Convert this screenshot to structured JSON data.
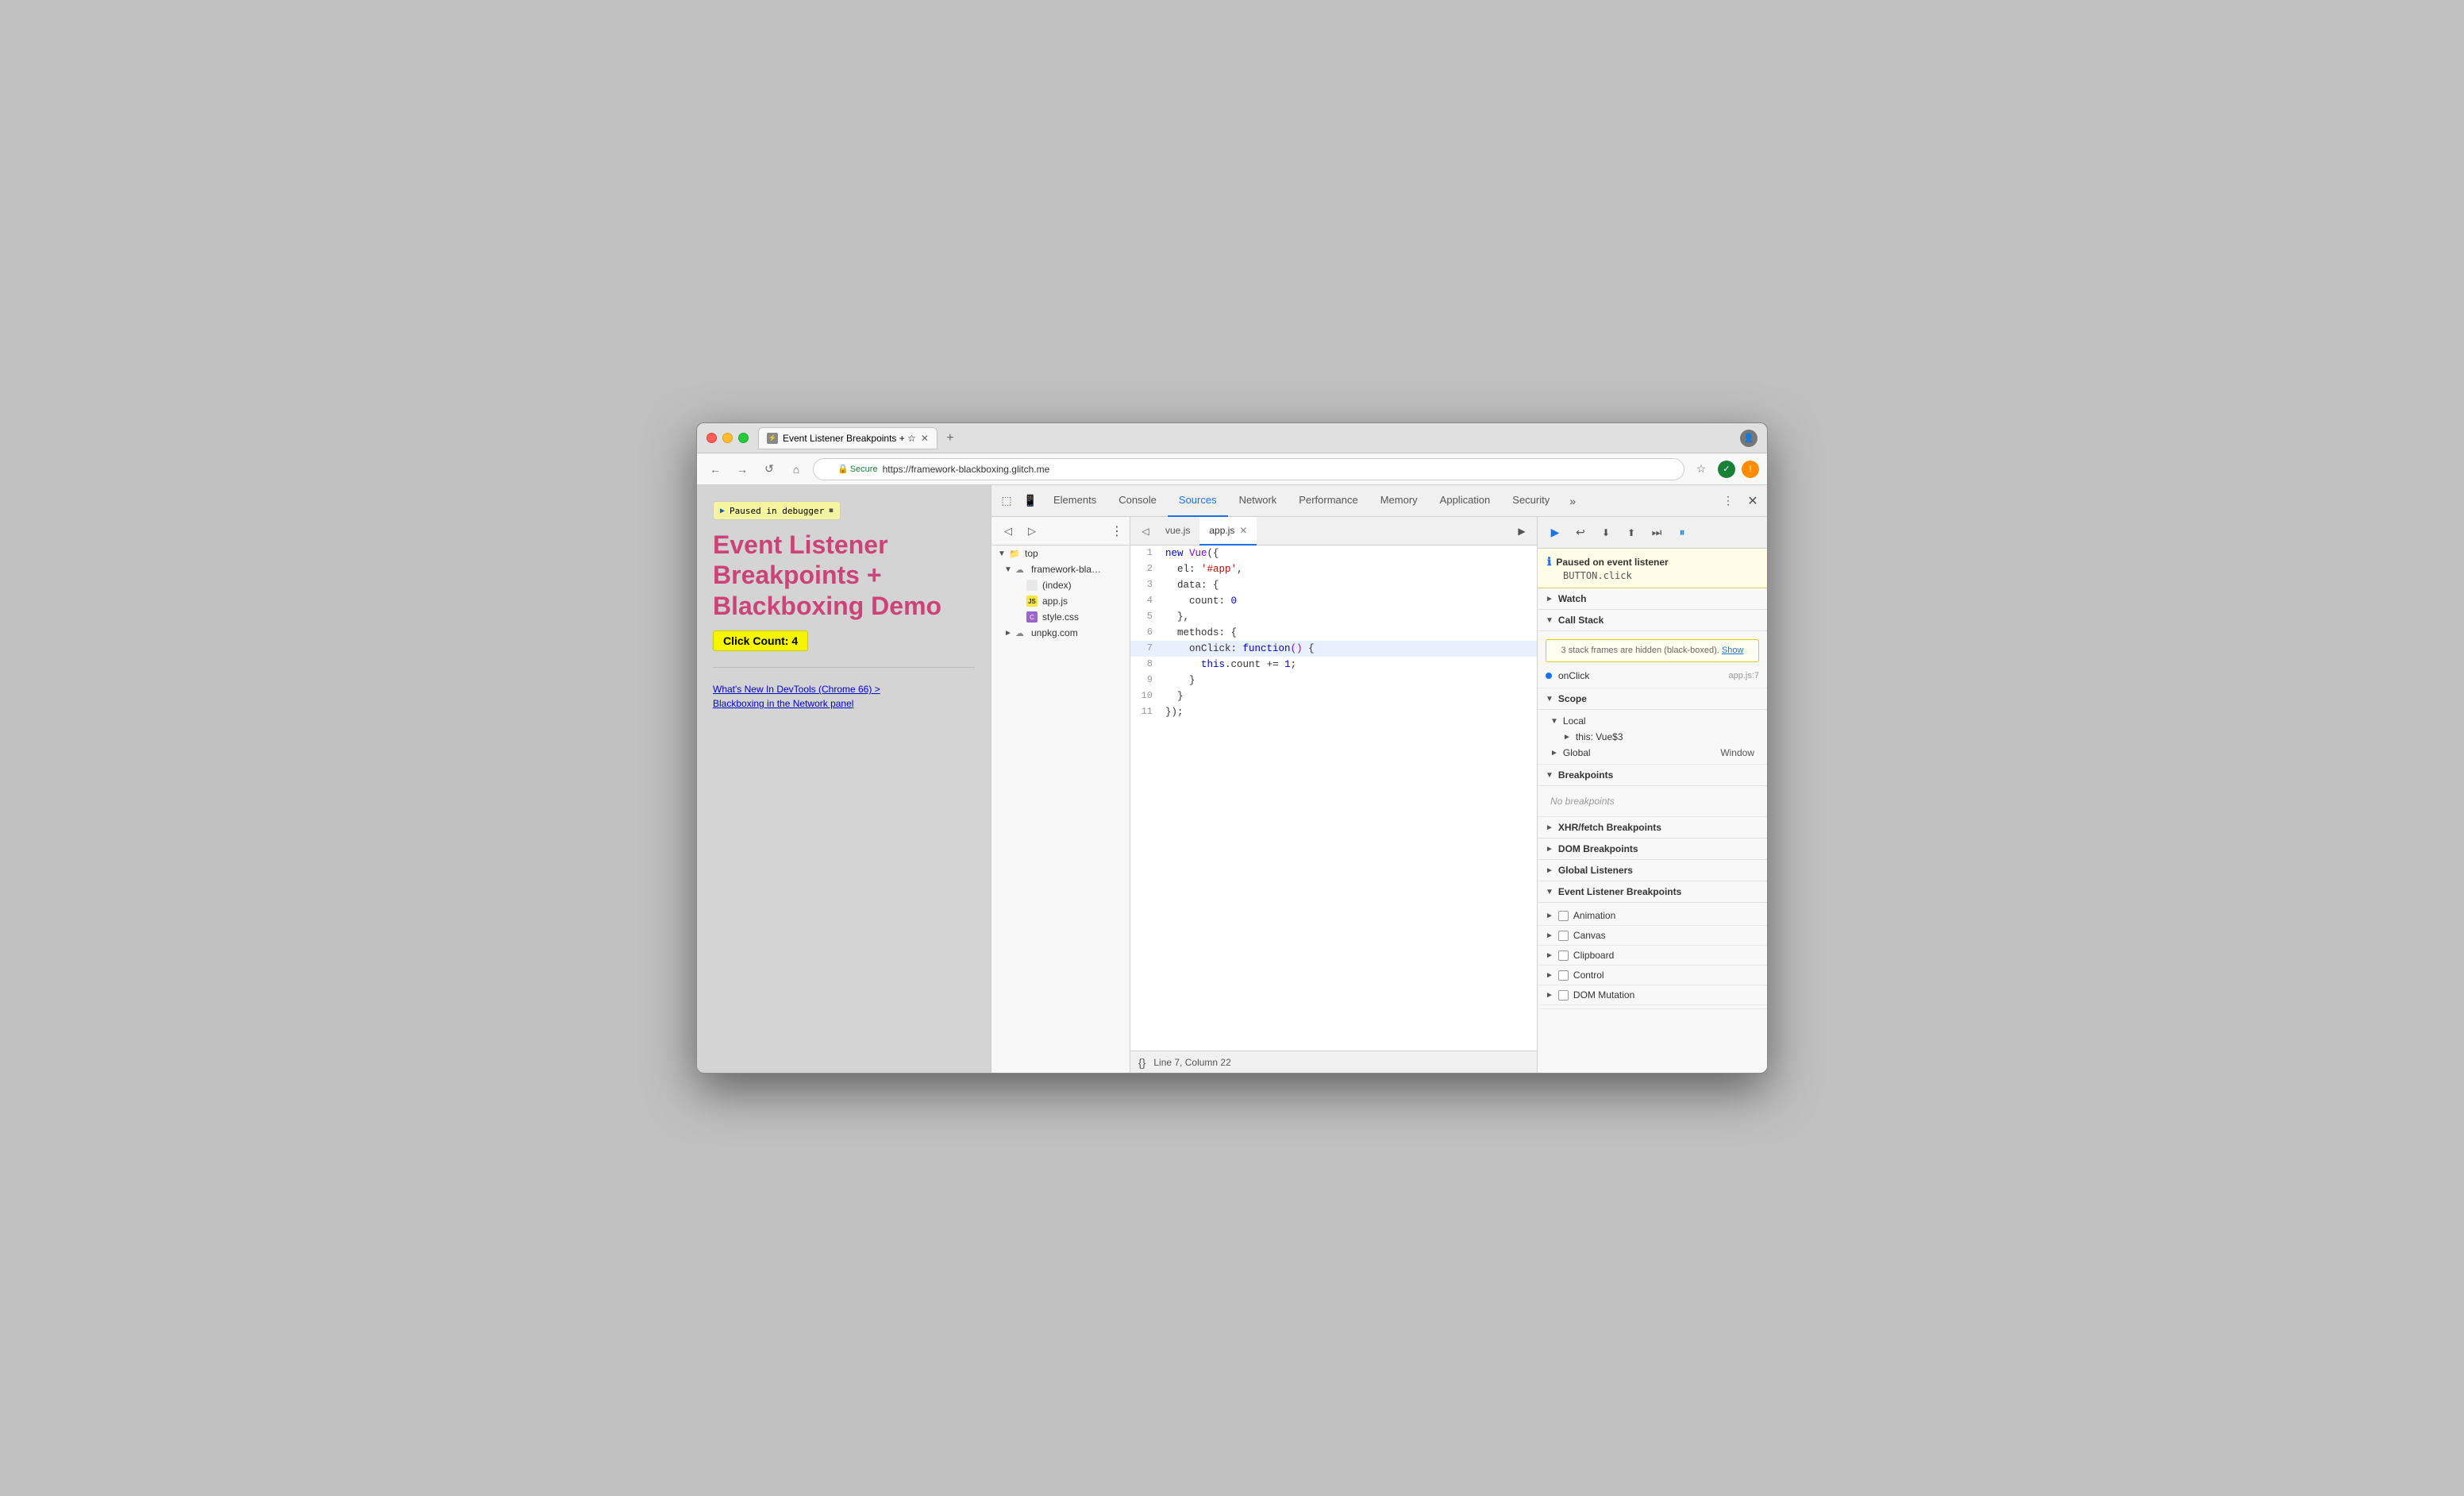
{
  "window": {
    "title": "Event Listener Breakpoints + ☆ □",
    "tab_label": "Event Listener Breakpoints + ☆",
    "new_tab_label": "+"
  },
  "address_bar": {
    "url": "https://framework-blackboxing.glitch.me",
    "secure_text": "Secure",
    "back_label": "←",
    "forward_label": "→",
    "refresh_label": "↺",
    "home_label": "⌂",
    "bookmark_label": "☆"
  },
  "page": {
    "paused_banner": "Paused in debugger",
    "title_line1": "Event Listener",
    "title_line2": "Breakpoints +",
    "title_line3": "Blackboxing Demo",
    "click_count": "Click Count: 4",
    "link1": "What's New In DevTools (Chrome 66) >",
    "link2": "Blackboxing in the Network panel"
  },
  "devtools": {
    "tabs": [
      {
        "label": "Elements",
        "active": false
      },
      {
        "label": "Console",
        "active": false
      },
      {
        "label": "Sources",
        "active": true
      },
      {
        "label": "Network",
        "active": false
      },
      {
        "label": "Performance",
        "active": false
      },
      {
        "label": "Memory",
        "active": false
      },
      {
        "label": "Application",
        "active": false
      },
      {
        "label": "Security",
        "active": false
      }
    ],
    "more_tabs_label": "»",
    "settings_label": "⋮",
    "close_label": "✕"
  },
  "file_tree": {
    "nav_back_label": "◁",
    "nav_forward_label": "▷",
    "more_label": "⋮",
    "items": [
      {
        "label": "top",
        "type": "folder",
        "indent": 0,
        "expanded": true
      },
      {
        "label": "framework-bla…",
        "type": "cloud-folder",
        "indent": 1,
        "expanded": true
      },
      {
        "label": "(index)",
        "type": "html",
        "indent": 2
      },
      {
        "label": "app.js",
        "type": "js",
        "indent": 2
      },
      {
        "label": "style.css",
        "type": "css",
        "indent": 2
      },
      {
        "label": "unpkg.com",
        "type": "cloud-folder",
        "indent": 1,
        "expanded": false
      }
    ]
  },
  "editor": {
    "tabs": [
      {
        "label": "vue.js",
        "active": false,
        "closeable": false
      },
      {
        "label": "app.js",
        "active": true,
        "closeable": true
      }
    ],
    "nav_left": "◁",
    "run_label": "▶",
    "code_lines": [
      {
        "num": 1,
        "content": "new Vue({",
        "highlighted": false
      },
      {
        "num": 2,
        "content": "  el: '#app',",
        "highlighted": false
      },
      {
        "num": 3,
        "content": "  data: {",
        "highlighted": false
      },
      {
        "num": 4,
        "content": "    count: 0",
        "highlighted": false
      },
      {
        "num": 5,
        "content": "  },",
        "highlighted": false
      },
      {
        "num": 6,
        "content": "  methods: {",
        "highlighted": false
      },
      {
        "num": 7,
        "content": "    onClick: function() {",
        "highlighted": true
      },
      {
        "num": 8,
        "content": "      this.count += 1;",
        "highlighted": false
      },
      {
        "num": 9,
        "content": "    }",
        "highlighted": false
      },
      {
        "num": 10,
        "content": "  }",
        "highlighted": false
      },
      {
        "num": 11,
        "content": "});",
        "highlighted": false
      }
    ],
    "footer_format": "{}",
    "footer_position": "Line 7, Column 22"
  },
  "debug_panel": {
    "toolbar_buttons": [
      {
        "label": "▶",
        "name": "resume",
        "primary": true
      },
      {
        "label": "↩",
        "name": "step-over"
      },
      {
        "label": "↓",
        "name": "step-into"
      },
      {
        "label": "↑",
        "name": "step-out"
      },
      {
        "label": "⏭",
        "name": "step"
      },
      {
        "label": "⏸",
        "name": "pause-exceptions"
      }
    ],
    "paused_notice": {
      "title": "Paused on event listener",
      "subtitle": "BUTTON.click"
    },
    "watch_label": "Watch",
    "call_stack": {
      "label": "Call Stack",
      "notice": "3 stack frames are hidden (black-boxed).",
      "show_link": "Show",
      "frames": [
        {
          "name": "onClick",
          "location": "app.js:7"
        }
      ]
    },
    "scope": {
      "label": "Scope",
      "local": {
        "label": "Local",
        "items": [
          {
            "name": "this",
            "value": "Vue$3"
          }
        ]
      },
      "global": {
        "label": "Global",
        "value": "Window"
      }
    },
    "breakpoints": {
      "label": "Breakpoints",
      "empty_text": "No breakpoints"
    },
    "xhr_breakpoints_label": "XHR/fetch Breakpoints",
    "dom_breakpoints_label": "DOM Breakpoints",
    "global_listeners_label": "Global Listeners",
    "event_listener_breakpoints": {
      "label": "Event Listener Breakpoints",
      "items": [
        {
          "label": "Animation",
          "checked": false
        },
        {
          "label": "Canvas",
          "checked": false
        },
        {
          "label": "Clipboard",
          "checked": false
        },
        {
          "label": "Control",
          "checked": false
        },
        {
          "label": "DOM Mutation",
          "checked": false
        }
      ]
    }
  }
}
